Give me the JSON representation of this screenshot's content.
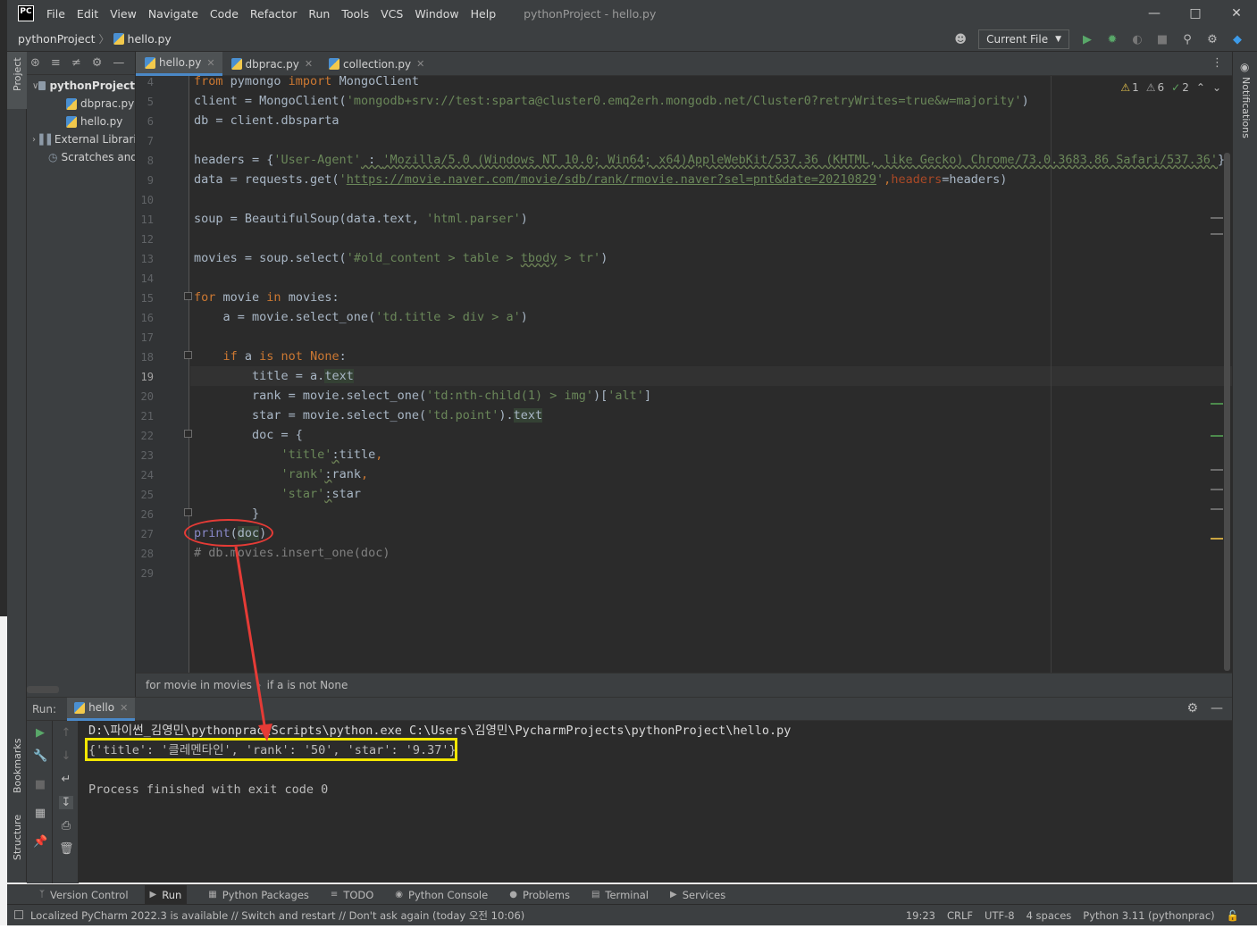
{
  "menubar": {
    "logo": "PC",
    "items": [
      "File",
      "Edit",
      "View",
      "Navigate",
      "Code",
      "Refactor",
      "Run",
      "Tools",
      "VCS",
      "Window",
      "Help"
    ],
    "window_title": "pythonProject - hello.py"
  },
  "navbar": {
    "project": "pythonProject",
    "file": "hello.py",
    "run_config": "Current File"
  },
  "project_tree": {
    "root": "pythonProject",
    "files": [
      "dbprac.py",
      "hello.py"
    ],
    "external": "External Librari",
    "scratches": "Scratches and"
  },
  "side_labels": {
    "project": "Project",
    "bookmarks": "Bookmarks",
    "structure": "Structure",
    "notifications": "Notifications"
  },
  "editor_tabs": [
    {
      "label": "hello.py",
      "active": true
    },
    {
      "label": "dbprac.py",
      "active": false
    },
    {
      "label": "collection.py",
      "active": false
    }
  ],
  "inspection": {
    "warnings": "1",
    "weak_warnings": "6",
    "typos": "2"
  },
  "line_numbers": [
    "4",
    "5",
    "6",
    "7",
    "8",
    "9",
    "10",
    "11",
    "12",
    "13",
    "14",
    "15",
    "16",
    "17",
    "18",
    "19",
    "20",
    "21",
    "22",
    "23",
    "24",
    "25",
    "26",
    "27",
    "28",
    "29"
  ],
  "current_line": "19",
  "code": {
    "l4_from": "from",
    "l4_mod": " pymongo ",
    "l4_import": "import",
    "l4_name": " MongoClient",
    "l5_a": "client = MongoClient(",
    "l5_s": "'mongodb+srv://test:sparta@cluster0.emq2erh.mongodb.net/Cluster0?retryWrites=true&w=majority'",
    "l5_b": ")",
    "l6": "db = client.dbsparta",
    "l8_a": "headers = {",
    "l8_k": "'User-Agent'",
    "l8_c": " : ",
    "l8_v": "'Mozilla/5.0 (Windows NT 10.0; Win64; x64)AppleWebKit/537.36 (KHTML, like Gecko) Chrome/73.0.3683.86 Safari/537.36'",
    "l8_b": "}",
    "l9_a": "data = requests.get(",
    "l9_q1": "'",
    "l9_url": "https://movie.naver.com/movie/sdb/rank/rmovie.naver?sel=pnt&date=20210829",
    "l9_q2": "'",
    "l9_comma": ",",
    "l9_kw": "headers",
    "l9_b": "=headers)",
    "l11_a": "soup = BeautifulSoup(data.text, ",
    "l11_s": "'html.parser'",
    "l11_b": ")",
    "l13_a": "movies = soup.select(",
    "l13_s1": "'#old_content > table > ",
    "l13_s2": "tbody",
    "l13_s3": " > tr'",
    "l13_b": ")",
    "l15_for": "for",
    "l15_a": " movie ",
    "l15_in": "in",
    "l15_b": " movies:",
    "l16_a": "    a = movie.select_one(",
    "l16_s": "'td.title > div > a'",
    "l16_b": ")",
    "l18_if": "    if",
    "l18_a": " a ",
    "l18_isnot": "is not",
    "l18_none": " None",
    "l18_b": ":",
    "l19_a": "        title = a.",
    "l19_b": "text",
    "l20_a": "        rank = movie.select_one(",
    "l20_s1": "'td:nth-child(1) > img'",
    "l20_b": ")[",
    "l20_s2": "'alt'",
    "l20_c": "]",
    "l21_a": "        star = movie.select_one(",
    "l21_s": "'td.point'",
    "l21_b": ").",
    "l21_c": "text",
    "l22": "        doc = {",
    "l23_s": "            'title'",
    "l23_a": ":",
    "l23_b": "title",
    "l23_c": ",",
    "l24_s": "            'rank'",
    "l24_a": ":",
    "l24_b": "rank",
    "l24_c": ",",
    "l25_s": "            'star'",
    "l25_a": ":",
    "l25_b": "star",
    "l26": "        }",
    "l27_a": "print",
    "l27_b": "(",
    "l27_c": "doc",
    "l27_d": ")",
    "l28": "# db.movies.insert_one(doc)"
  },
  "breadcrumb": [
    "for movie in movies",
    "if a is not None"
  ],
  "run": {
    "label": "Run:",
    "tab": "hello",
    "cmd": "D:\\파이썬_김영민\\pythonprac\\Scripts\\python.exe C:\\Users\\김영민\\PycharmProjects\\pythonProject\\hello.py",
    "output": "{'title': '클레멘타인', 'rank': '50', 'star': '9.37'}",
    "finished": "Process finished with exit code 0"
  },
  "bottom_tools": [
    "Version Control",
    "Run",
    "Python Packages",
    "TODO",
    "Python Console",
    "Problems",
    "Terminal",
    "Services"
  ],
  "status": {
    "message": "Localized PyCharm 2022.3 is available // Switch and restart // Don't ask again (today 오전 10:06)",
    "position": "19:23",
    "line_sep": "CRLF",
    "encoding": "UTF-8",
    "indent": "4 spaces",
    "interpreter": "Python 3.11 (pythonprac)"
  },
  "colors": {
    "annotation_circle": "#e53b36",
    "annotation_box": "#f2e600",
    "keyword": "#cc7832",
    "string": "#6a8759"
  }
}
